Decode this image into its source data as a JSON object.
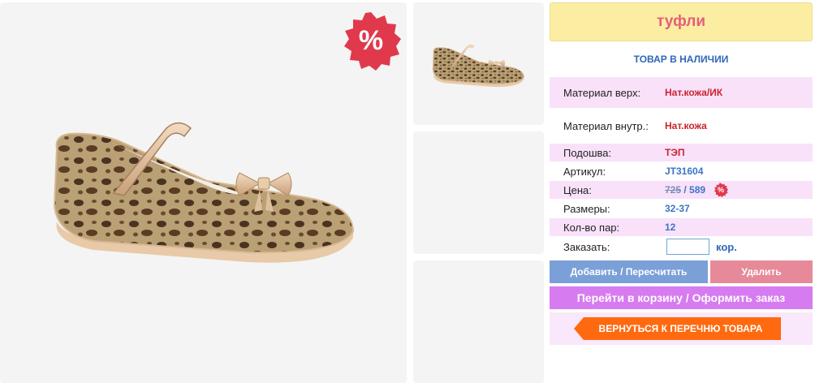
{
  "product": {
    "title": "туфли",
    "stock_status": "ТОВАР В НАЛИЧИИ"
  },
  "badge": {
    "symbol": "%"
  },
  "attributes": [
    {
      "label": "Материал верх:",
      "value": "Нат.кожа/ИК"
    },
    {
      "label": "Материал внутр.:",
      "value": "Нат.кожа"
    },
    {
      "label": "Подошва:",
      "value": "ТЭП"
    },
    {
      "label": "Артикул:",
      "value": "JT31604"
    }
  ],
  "price": {
    "label": "Цена:",
    "old": "725",
    "separator": " / ",
    "new": "589"
  },
  "sizes": {
    "label": "Размеры:",
    "value": "32-37"
  },
  "pairs": {
    "label": "Кол-во пар:",
    "value": "12"
  },
  "order": {
    "label": "Заказать:",
    "input_value": "",
    "unit": "кор."
  },
  "buttons": {
    "add": "Добавить / Пересчитать",
    "delete": "Удалить",
    "cart": "Перейти в корзину / Оформить заказ",
    "back": "ВЕРНУТЬСЯ К ПЕРЕЧНЮ ТОВАРА"
  },
  "colors": {
    "title_bg": "#fbeea3",
    "title_text": "#e45f7a",
    "accent_blue": "#2f66b9",
    "pink_row": "#f9e1fa",
    "add_button": "#7ba0d8",
    "delete_button": "#e68a9a",
    "cart_button": "#d77bf1",
    "back_button": "#ff6a10",
    "sale_badge": "#e0394c"
  }
}
